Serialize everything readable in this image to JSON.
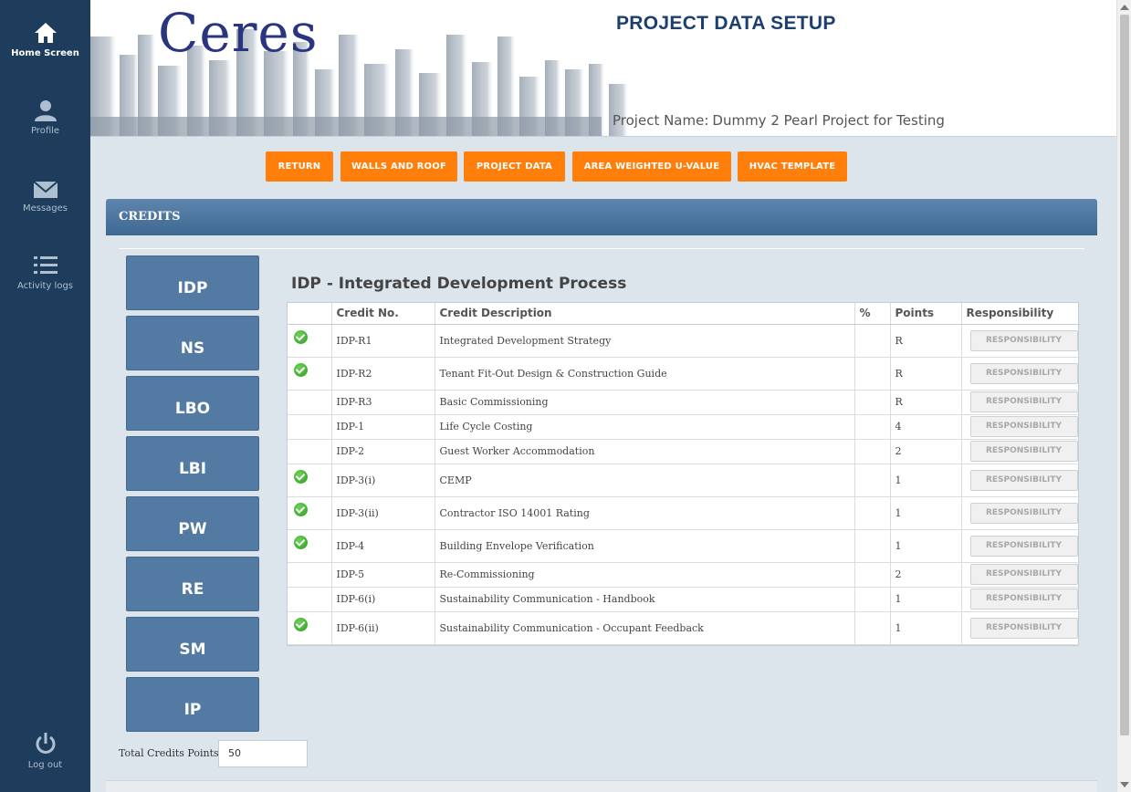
{
  "sidebar": {
    "items": [
      {
        "label": "Home Screen",
        "icon": "home-icon"
      },
      {
        "label": "Profile",
        "icon": "user-icon"
      },
      {
        "label": "Messages",
        "icon": "envelope-icon"
      },
      {
        "label": "Activity logs",
        "icon": "list-icon"
      }
    ],
    "logout_label": "Log out"
  },
  "header": {
    "brand": "Ceres",
    "title": "PROJECT DATA SETUP",
    "project_name_label": "Project Name:",
    "project_name": "Dummy 2 Pearl Project for Testing"
  },
  "toolbar": {
    "buttons": [
      "RETURN",
      "WALLS AND ROOF",
      "PROJECT DATA",
      "AREA WEIGHTED U-VALUE",
      "HVAC TEMPLATE"
    ]
  },
  "credits": {
    "panel_title": "CREDITS",
    "categories": [
      "IDP",
      "NS",
      "LBO",
      "LBI",
      "PW",
      "RE",
      "SM",
      "IP"
    ],
    "total_label": "Total Credits Points:",
    "total_value": "50",
    "section_title": "IDP - Integrated Development Process",
    "columns": [
      "Credit No.",
      "Credit Description",
      "%",
      "Points",
      "Responsibility"
    ],
    "responsibility_label": "RESPONSIBILITY",
    "rows": [
      {
        "checked": true,
        "no": "IDP-R1",
        "desc": "Integrated Development Strategy",
        "pct": "",
        "points": "R"
      },
      {
        "checked": true,
        "no": "IDP-R2",
        "desc": "Tenant Fit-Out Design & Construction Guide",
        "pct": "",
        "points": "R"
      },
      {
        "checked": false,
        "no": "IDP-R3",
        "desc": "Basic Commissioning",
        "pct": "",
        "points": "R"
      },
      {
        "checked": false,
        "no": "IDP-1",
        "desc": "Life Cycle Costing",
        "pct": "",
        "points": "4"
      },
      {
        "checked": false,
        "no": "IDP-2",
        "desc": "Guest Worker Accommodation",
        "pct": "",
        "points": "2"
      },
      {
        "checked": true,
        "no": "IDP-3(i)",
        "desc": "CEMP",
        "pct": "",
        "points": "1"
      },
      {
        "checked": true,
        "no": "IDP-3(ii)",
        "desc": "Contractor ISO 14001 Rating",
        "pct": "",
        "points": "1"
      },
      {
        "checked": true,
        "no": "IDP-4",
        "desc": "Building Envelope Verification",
        "pct": "",
        "points": "1"
      },
      {
        "checked": false,
        "no": "IDP-5",
        "desc": "Re-Commissioning",
        "pct": "",
        "points": "2"
      },
      {
        "checked": false,
        "no": "IDP-6(i)",
        "desc": "Sustainability Communication - Handbook",
        "pct": "",
        "points": "1"
      },
      {
        "checked": true,
        "no": "IDP-6(ii)",
        "desc": "Sustainability Communication - Occupant Feedback",
        "pct": "",
        "points": "1"
      }
    ]
  },
  "colors": {
    "sidebar_bg": "#1e3d5c",
    "accent_orange": "#ff7f0a",
    "category_blue": "#537aa3",
    "title_navy": "#1d3f6e",
    "check_green": "#2b9a1d"
  }
}
